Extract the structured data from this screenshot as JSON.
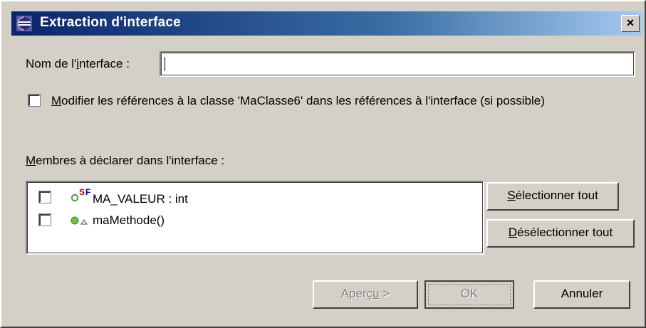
{
  "dialog": {
    "title": "Extraction d'interface",
    "close_label": "×"
  },
  "interface_name": {
    "label_prefix": "Nom de l'",
    "label_mnemonic": "i",
    "label_suffix": "nterface :",
    "value": ""
  },
  "modify_refs": {
    "checked": false,
    "label_mnemonic": "M",
    "label_rest": "odifier les références à la classe 'MaClasse6' dans les références à l'interface (si possible)"
  },
  "members": {
    "label_mnemonic": "M",
    "label_rest": "embres à déclarer dans l'interface :",
    "items": [
      {
        "label": "MA_VALEUR : int",
        "checked": false,
        "icon": "static-final-field-icon",
        "badge": "S F"
      },
      {
        "label": "maMethode()",
        "checked": false,
        "icon": "default-method-icon",
        "badge": ""
      }
    ]
  },
  "side_buttons": {
    "select_all_mnemonic": "S",
    "select_all_rest": "électionner tout",
    "deselect_all_mnemonic": "D",
    "deselect_all_rest": "ésélectionner tout"
  },
  "footer": {
    "preview_prefix": "Aperç",
    "preview_mnemonic": "u",
    "preview_suffix": " >",
    "ok_label": "OK",
    "cancel_label": "Annuler"
  },
  "colors": {
    "title_gradient_start": "#0a246a",
    "title_gradient_end": "#a6caf0",
    "face": "#d4d0c8",
    "field_icon_green": "#4a9a4a",
    "method_icon_green": "#6cc04a",
    "static_badge": "#c00000",
    "final_badge": "#0000c0"
  }
}
